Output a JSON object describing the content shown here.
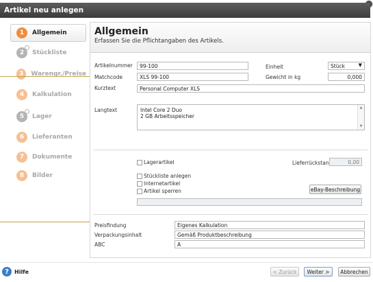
{
  "window": {
    "title": "Artikel neu anlegen"
  },
  "sidebar": {
    "items": [
      {
        "num": "1",
        "label": "Allgemein",
        "active": true
      },
      {
        "num": "2",
        "label": "Stückliste"
      },
      {
        "num": "3",
        "label": "Warengr./Preise"
      },
      {
        "num": "4",
        "label": "Kalkulation"
      },
      {
        "num": "5",
        "label": "Lager"
      },
      {
        "num": "6",
        "label": "Lieferanten"
      },
      {
        "num": "7",
        "label": "Dokumente"
      },
      {
        "num": "8",
        "label": "Bilder"
      }
    ]
  },
  "header": {
    "title": "Allgemein",
    "subtitle": "Erfassen Sie die Pflichtangaben des Artikels."
  },
  "form": {
    "artikelnummer_label": "Artikelnummer",
    "artikelnummer": "99-100",
    "matchcode_label": "Matchcode",
    "matchcode": "XLS 99-100",
    "kurztext_label": "Kurztext",
    "kurztext": "Personal Computer XLS",
    "einheit_label": "Einheit",
    "einheit": "Stück",
    "gewicht_label": "Gewicht in kg",
    "gewicht": "0,000",
    "langtext_label": "Langtext",
    "langtext_line1": "Intel Core 2 Duo",
    "langtext_line2": "2 GB Arbeitsspeicher",
    "lagerartikel": "Lagerartikel",
    "lieferrueckstand_label": "Lieferrückstand",
    "lieferrueckstand": "0,00",
    "stueckliste_anlegen": "Stückliste anlegen",
    "internetartikel": "Internetartikel",
    "artikel_sperren": "Artikel sperren",
    "ebay_button": "eBay-Beschreibung",
    "preisfindung_label": "Preisfindung",
    "preisfindung": "Eigenes Kalkulation",
    "verpackungsinhalt_label": "Verpackungsinhalt",
    "verpackungsinhalt": "Gemäß Produktbeschreibung",
    "abc_label": "ABC",
    "abc": "A"
  },
  "footer": {
    "help": "Hilfe",
    "back": "< Zurück",
    "next": "Weiter >",
    "cancel": "Abbrechen"
  },
  "colors": {
    "accent": "#f18c3a",
    "inactive": "#b4b4b4",
    "leader": "#c6a24b",
    "titlebar": "#4a4a4a"
  },
  "icons": {
    "help": "question-circle-icon",
    "close": "close-icon",
    "dropdown": "chevron-down-icon"
  }
}
